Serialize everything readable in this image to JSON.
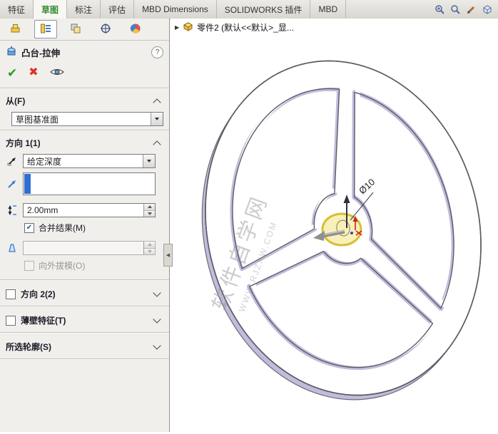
{
  "ribbon": {
    "tabs": [
      {
        "label": "特征"
      },
      {
        "label": "草图"
      },
      {
        "label": "标注"
      },
      {
        "label": "评估"
      },
      {
        "label": "MBD Dimensions"
      },
      {
        "label": "SOLIDWORKS 插件"
      },
      {
        "label": "MBD"
      }
    ],
    "active_tab": "草图"
  },
  "property_manager": {
    "title": "凸台-拉伸",
    "from": {
      "label": "从(F)",
      "plane": "草图基准面"
    },
    "direction1": {
      "label": "方向 1(1)",
      "end_condition": "给定深度",
      "depth": "2.00mm",
      "draft_value": "",
      "merge_label": "合并结果(M)",
      "merge_checked": true,
      "outward_label": "向外拔模(O)",
      "outward_checked": false
    },
    "direction2": {
      "label": "方向 2(2)",
      "checked": false
    },
    "thin": {
      "label": "薄壁特征(T)",
      "checked": false
    },
    "contours": {
      "label": "所选轮廓(S)"
    }
  },
  "viewport": {
    "tree_item": "零件2 (默认<<默认>_显...",
    "dimension": "Ø10",
    "watermark": {
      "line1": "软件自学网",
      "line2": "WWW.RJZXW.COM"
    }
  },
  "icons": {
    "confirm": "✔",
    "cancel": "✖",
    "help": "?",
    "expand": "▶",
    "collapse": "◀"
  },
  "colors": {
    "accent_green": "#2f8b2f",
    "model_shade": "#c1bcdc",
    "highlight_yellow": "#e8d24a",
    "selection_blue": "#2f6fd0"
  }
}
